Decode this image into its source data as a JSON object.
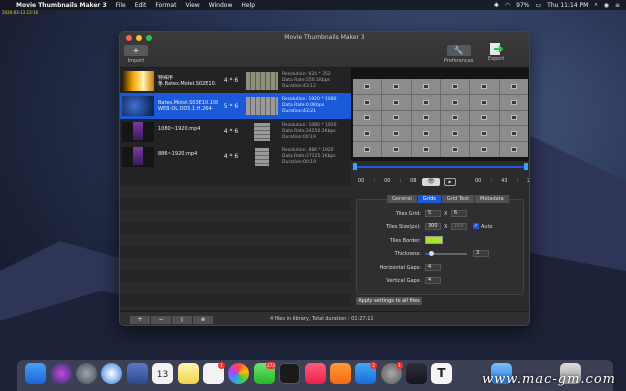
{
  "menubar": {
    "app_name": "Movie Thumbnails Maker 3",
    "items": [
      "File",
      "Edit",
      "Format",
      "View",
      "Window",
      "Help"
    ],
    "battery": "97%",
    "clock": "Thu 11:14 PM"
  },
  "stamp": "2020-03-13 23:16",
  "window": {
    "title": "Movie Thumbnails Maker 3",
    "import_label": "Import",
    "import_symbol": "+",
    "preferences_label": "Preferences",
    "export_label": "Export"
  },
  "files": [
    {
      "name": "特殊序\n条.Bates.Motel.S02E10.中英",
      "grid": "4 * 6",
      "info": [
        "Resolution: 624 * 352",
        "Data Rate:550.1Kbps",
        "Duration:43:12"
      ]
    },
    {
      "name": "Bates.Motel.S03E10.1080p.\nWEB-DL.DD5.1.H.264-",
      "grid": "5 * 6",
      "info": [
        "Resolution: 1920 * 1080",
        "Data Rate:0.0Kbps",
        "Duration:43:21"
      ]
    },
    {
      "name": "1080~1920.mp4",
      "grid": "4 * 6",
      "info": [
        "Resolution: 1080 * 1920",
        "Data Rate:24550.2Kbps",
        "Duration:00:19"
      ]
    },
    {
      "name": "886~1920.mp4",
      "grid": "4 * 6",
      "info": [
        "Resolution: 886 * 1920",
        "Data Rate:27225.1Kbps",
        "Duration:00:19"
      ]
    }
  ],
  "timecode": {
    "start": [
      "00",
      "00",
      "08"
    ],
    "end": [
      "00",
      "43",
      "21"
    ]
  },
  "tabs": [
    "General",
    "Grids",
    "Grid Text",
    "Metadata"
  ],
  "active_tab": "Grids",
  "grids": {
    "tiles_grid_label": "Tiles Grid:",
    "cols": "5",
    "x": "X",
    "rows": "6",
    "tiles_size_label": "Tiles Size(px):",
    "width": "300",
    "height": "169",
    "auto_label": "Auto",
    "auto_checked": true,
    "tiles_border_label": "Tiles Border:",
    "border_color": "#a6e22e",
    "thickness_label": "Thickness:",
    "thickness": "3",
    "thickness_level": 0.15,
    "hgaps_label": "Horizontal Gaps:",
    "hgaps": "4",
    "vgaps_label": "Vertical Gaps:",
    "vgaps": "4"
  },
  "apply_label": "Apply settings to all files",
  "bottom": {
    "add": "+",
    "remove": "−",
    "status": "4 files in library, Total duration : 01:27:11"
  },
  "watermark": "www.mac-gm.com",
  "badges": {
    "calendar": "13",
    "reminders": "1",
    "messages": "273",
    "appstore": "2",
    "prefs": "1"
  }
}
